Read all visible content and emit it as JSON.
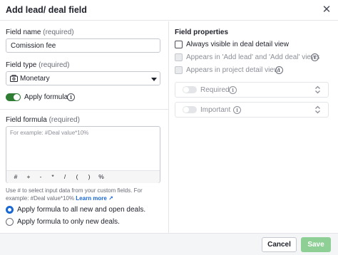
{
  "dialog": {
    "title": "Add lead/ deal field",
    "close_icon": "close-icon"
  },
  "left": {
    "field_name": {
      "label": "Field name",
      "required": "(required)",
      "value": "Comission fee"
    },
    "field_type": {
      "label": "Field type",
      "required": "(required)",
      "value": "Monetary",
      "icon": "money-icon"
    },
    "apply_formula": {
      "label": "Apply formula",
      "enabled": true
    },
    "field_formula": {
      "label": "Field formula",
      "required": "(required)",
      "placeholder": "For example: #Deal value*10%",
      "operators": [
        "#",
        "+",
        "-",
        "*",
        "/",
        "(",
        ")",
        "%"
      ]
    },
    "help": {
      "text": "Use # to select input data from your custom fields. For example: #Deal value*10%",
      "link": "Learn more ↗"
    },
    "radios": [
      {
        "label": "Apply formula to all new and open deals.",
        "checked": true
      },
      {
        "label": "Apply formula to only new deals.",
        "checked": false
      }
    ]
  },
  "right": {
    "title": "Field properties",
    "checkboxes": [
      {
        "label": "Always visible in deal detail view",
        "disabled": false,
        "checked": false
      },
      {
        "label": "Appears in 'Add lead' and 'Add deal' views",
        "disabled": true,
        "checked": false
      },
      {
        "label": "Appears in project detail view",
        "disabled": true,
        "checked": false
      }
    ],
    "selects": [
      {
        "label": "Required",
        "enabled": false
      },
      {
        "label": "Important",
        "enabled": false
      }
    ]
  },
  "footer": {
    "cancel": "Cancel",
    "save": "Save"
  },
  "colors": {
    "accent_green": "#2e7d32",
    "save_disabled": "#8ecf95",
    "link_blue": "#1967d2"
  }
}
